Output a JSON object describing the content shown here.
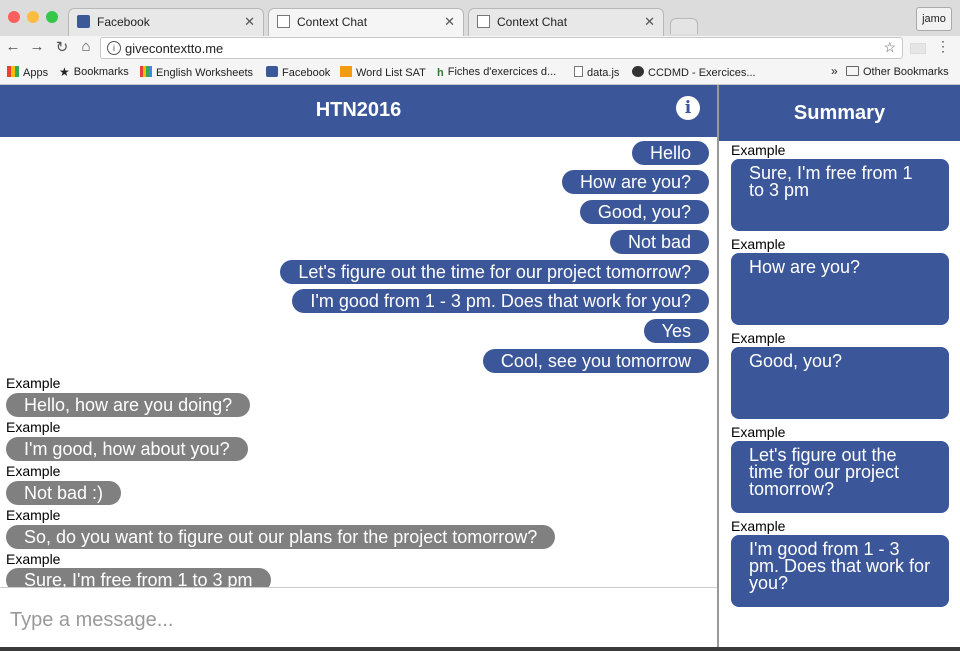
{
  "browser": {
    "tabs": [
      {
        "label": "Facebook"
      },
      {
        "label": "Context Chat"
      },
      {
        "label": "Context Chat"
      }
    ],
    "user": "jamo",
    "url": "givecontextto.me",
    "bookmarks": [
      {
        "label": "Apps"
      },
      {
        "label": "Bookmarks"
      },
      {
        "label": "English Worksheets"
      },
      {
        "label": "Facebook"
      },
      {
        "label": "Word List SAT"
      },
      {
        "label": "Fiches d'exercices d..."
      },
      {
        "label": "data.js"
      },
      {
        "label": "CCDMD - Exercices..."
      }
    ],
    "overflow": "»",
    "other_bookmarks": "Other Bookmarks"
  },
  "app": {
    "title": "HTN2016",
    "info_icon": "i",
    "summary_title": "Summary",
    "input_placeholder": "Type a message..."
  },
  "chat": {
    "sent": [
      "Hello",
      "How are you?",
      "Good, you?",
      "Not bad",
      "Let's figure out the time for our project tomorrow?",
      "I'm good from 1 - 3 pm. Does that work for you?",
      "Yes",
      "Cool, see you tomorrow"
    ],
    "examples": [
      {
        "label": "Example",
        "text": "Hello, how are you doing?"
      },
      {
        "label": "Example",
        "text": "I'm good, how about you?"
      },
      {
        "label": "Example",
        "text": "Not bad :)"
      },
      {
        "label": "Example",
        "text": "So, do you want to figure out our plans for the project tomorrow?"
      },
      {
        "label": "Example",
        "text": "Sure, I'm free from 1 to 3 pm"
      }
    ]
  },
  "summary": [
    {
      "label": "Example",
      "text": "Sure, I'm free from 1 to 3 pm"
    },
    {
      "label": "Example",
      "text": "How are you?"
    },
    {
      "label": "Example",
      "text": "Good, you?"
    },
    {
      "label": "Example",
      "text": "Let's figure out the time for our project tomorrow?"
    },
    {
      "label": "Example",
      "text": "I'm good from 1 - 3 pm. Does that work for you?"
    }
  ],
  "colors": {
    "accent": "#3b5699",
    "received_bubble": "#808080"
  }
}
